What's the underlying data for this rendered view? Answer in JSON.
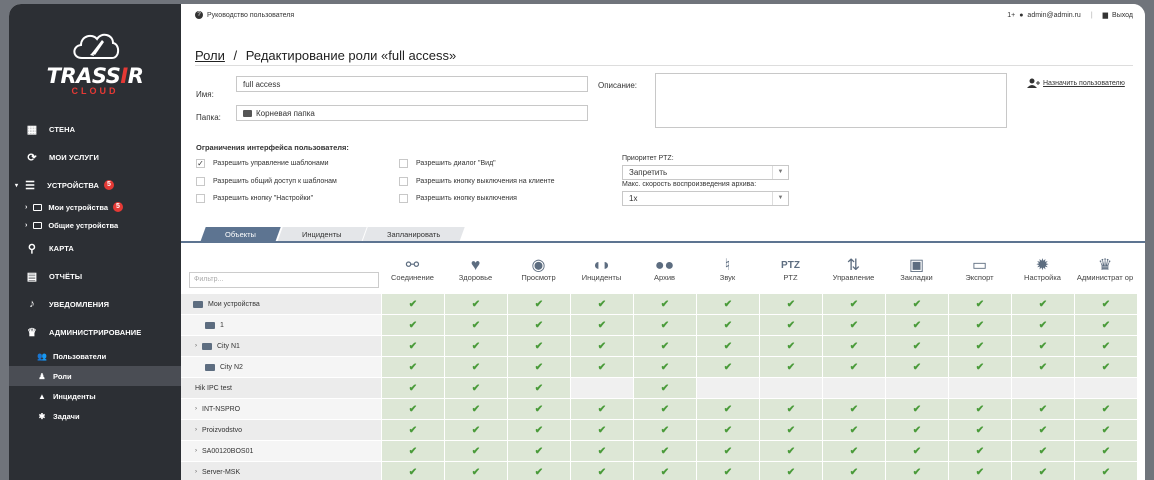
{
  "topbar": {
    "help": "Руководство пользователя",
    "user_prefix": "1+",
    "user": "admin@admin.ru",
    "logout": "Выход"
  },
  "brand": {
    "name_a": "TRASS",
    "name_b": "R",
    "sub": "CLOUD"
  },
  "nav": {
    "wall": "СТЕНА",
    "services": "МОИ УСЛУГИ",
    "devices": "УСТРОЙСТВА",
    "devices_badge": "5",
    "my_devices": "Мои устройства",
    "my_devices_badge": "5",
    "shared_devices": "Общие устройства",
    "map": "КАРТА",
    "reports": "ОТЧЁТЫ",
    "notifications": "УВЕДОМЛЕНИЯ",
    "admin": "АДМИНИСТРИРОВАНИЕ",
    "users": "Пользователи",
    "roles": "Роли",
    "incidents": "Инциденты",
    "tasks": "Задачи"
  },
  "page": {
    "breadcrumb_link": "Роли",
    "breadcrumb_sep": "/",
    "title": "Редактирование роли «full access»"
  },
  "form": {
    "name_label": "Имя:",
    "name_value": "full access",
    "folder_label": "Папка:",
    "folder_value": "Корневая папка",
    "desc_label": "Описание:",
    "desc_value": "",
    "assign": "Назначить пользователю"
  },
  "restrictions": {
    "title": "Ограничения интерфейса пользователя:",
    "c1": "Разрешить управление шаблонами",
    "c1_checked": true,
    "c2": "Разрешить общий доступ к шаблонам",
    "c2_checked": false,
    "c3": "Разрешить кнопку \"Настройки\"",
    "c3_checked": false,
    "c4": "Разрешить диалог \"Вид\"",
    "c4_checked": false,
    "c5": "Разрешить кнопку выключения на клиенте",
    "c5_checked": false,
    "c6": "Разрешить кнопку выключения",
    "c6_checked": false,
    "ptz_label": "Приоритет PTZ:",
    "ptz_value": "Запретить",
    "speed_label": "Макс. скорость воспроизведения архива:",
    "speed_value": "1x"
  },
  "tabs": {
    "t1": "Объекты",
    "t2": "Инциденты",
    "t3": "Запланировать"
  },
  "filter_placeholder": "Фильтр...",
  "columns": {
    "c0": "Соединение",
    "c1": "Здоровье",
    "c2": "Просмотр",
    "c3": "Инциденты",
    "c4": "Архив",
    "c5": "Звук",
    "c6": "PTZ",
    "c7": "Управление",
    "c8": "Закладки",
    "c9": "Экспорт",
    "c10": "Настройка",
    "c11": "Администрат ор",
    "ptz_icon": "PTZ"
  },
  "rows": {
    "r0": "Мои устройства",
    "r1": "1",
    "r2": "City N1",
    "r3": "City N2",
    "r4": "Hik IPC test",
    "r5": "INT-NSPRO",
    "r6": "Proizvodstvo",
    "r7": "SA00120BOS01",
    "r8": "Server-MSK"
  },
  "check_glyph": "✔"
}
